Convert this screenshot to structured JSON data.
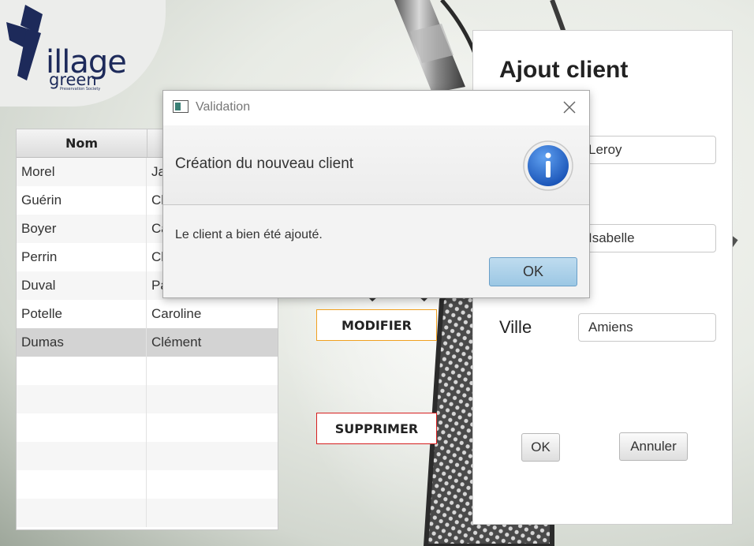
{
  "logo": {
    "main": "illage",
    "secondary": "green",
    "tagline": "Preservation Society"
  },
  "table": {
    "columns": [
      "Nom",
      ""
    ],
    "rows": [
      {
        "nom": "Morel",
        "prenom": "Ja"
      },
      {
        "nom": "Guérin",
        "prenom": "Ch"
      },
      {
        "nom": "Boyer",
        "prenom": "Ca"
      },
      {
        "nom": "Perrin",
        "prenom": "Cl"
      },
      {
        "nom": "Duval",
        "prenom": "Pa"
      },
      {
        "nom": "Potelle",
        "prenom": "Caroline"
      },
      {
        "nom": "Dumas",
        "prenom": "Clément"
      }
    ]
  },
  "actions": {
    "modify_label": "MODIFIER",
    "delete_label": "SUPPRIMER"
  },
  "form": {
    "title": "Ajout client",
    "nom_value": "Leroy",
    "prenom_value": "Isabelle",
    "ville_label": "Ville",
    "ville_value": "Amiens",
    "ok_label": "OK",
    "cancel_label": "Annuler"
  },
  "dialog": {
    "title": "Validation",
    "header": "Création du nouveau client",
    "message": "Le client a bien été ajouté.",
    "ok_label": "OK",
    "info_icon": "information-icon"
  },
  "colors": {
    "modify_border": "#f0a020",
    "delete_border": "#d61f1f",
    "dialog_ok": "#9cc7e4",
    "info_blue": "#2a6fd1",
    "logo_navy": "#1d2a5a"
  }
}
